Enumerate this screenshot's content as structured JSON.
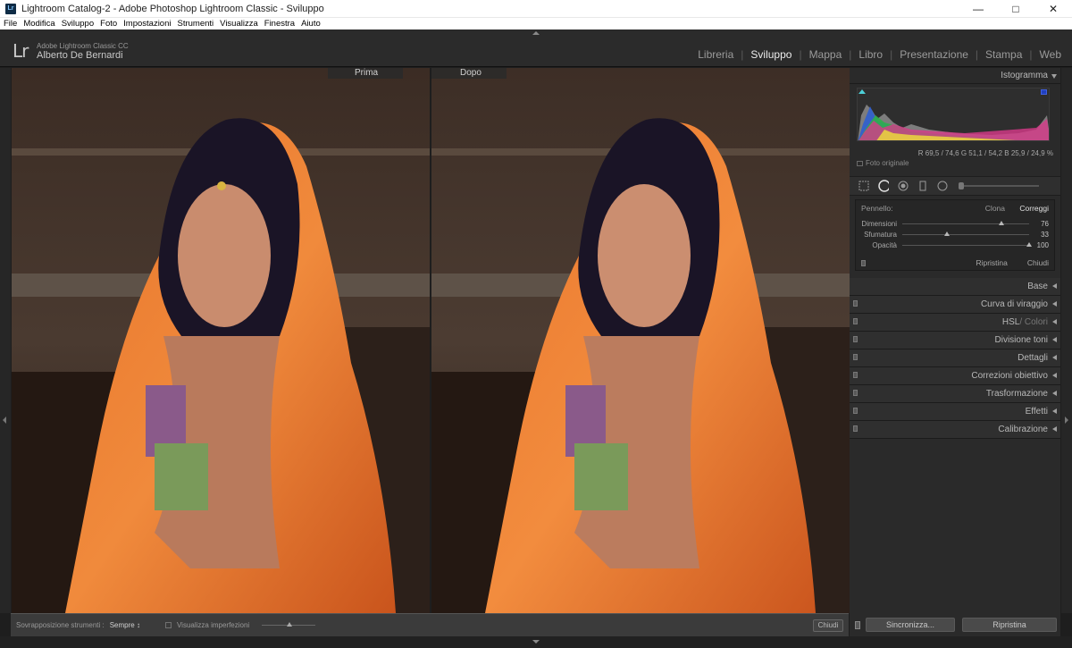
{
  "window": {
    "title": "Lightroom Catalog-2 - Adobe Photoshop Lightroom Classic - Sviluppo",
    "app_icon": "Lr"
  },
  "menubar": {
    "items": [
      "File",
      "Modifica",
      "Sviluppo",
      "Foto",
      "Impostazioni",
      "Strumenti",
      "Visualizza",
      "Finestra",
      "Aiuto"
    ]
  },
  "header": {
    "logo": "Lr",
    "product": "Adobe Lightroom Classic CC",
    "user": "Alberto De Bernardi",
    "modules": [
      "Libreria",
      "Sviluppo",
      "Mappa",
      "Libro",
      "Presentazione",
      "Stampa",
      "Web"
    ],
    "active_module": "Sviluppo"
  },
  "views": {
    "before_label": "Prima",
    "after_label": "Dopo"
  },
  "right_panel": {
    "histogram": {
      "title": "Istogramma",
      "readout": "R 69,5 / 74,6  G 51,1 / 54,2  B 25,9 / 24,9 %",
      "original_photo": "Foto originale"
    },
    "brush": {
      "label": "Pennello:",
      "mode_clone": "Clona",
      "mode_heal": "Correggi",
      "sliders": [
        {
          "label": "Dimensioni",
          "value": "76",
          "level": 0.76
        },
        {
          "label": "Sfumatura",
          "value": "33",
          "level": 0.33
        },
        {
          "label": "Opacità",
          "value": "100",
          "level": 1.0
        }
      ],
      "reset": "Ripristina",
      "close": "Chiudi"
    },
    "panels": [
      {
        "label": "Base",
        "dim": ""
      },
      {
        "label": "Curva di viraggio",
        "dim": ""
      },
      {
        "label": "HSL",
        "dim": " / Colori"
      },
      {
        "label": "Divisione toni",
        "dim": ""
      },
      {
        "label": "Dettagli",
        "dim": ""
      },
      {
        "label": "Correzioni obiettivo",
        "dim": ""
      },
      {
        "label": "Trasformazione",
        "dim": ""
      },
      {
        "label": "Effetti",
        "dim": ""
      },
      {
        "label": "Calibrazione",
        "dim": ""
      }
    ]
  },
  "toolbar": {
    "overlay_label": "Sovrapposizione strumenti :",
    "overlay_value": "Sempre",
    "visualize_label": "Visualizza imperfezioni",
    "close": "Chiudi"
  },
  "right_bottom": {
    "sync": "Sincronizza...",
    "reset": "Ripristina"
  }
}
